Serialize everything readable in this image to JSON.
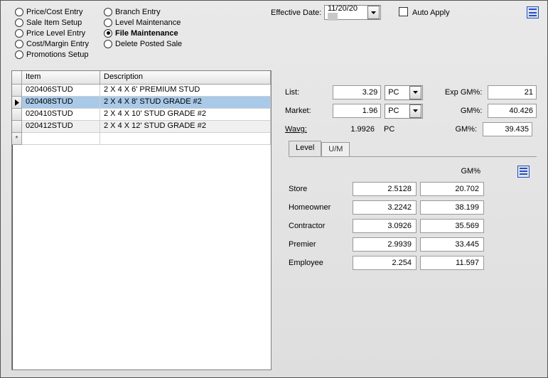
{
  "header": {
    "radio_col1": [
      {
        "label": "Price/Cost Entry",
        "selected": false
      },
      {
        "label": "Sale Item Setup",
        "selected": false
      },
      {
        "label": "Price Level Entry",
        "selected": false
      },
      {
        "label": "Cost/Margin Entry",
        "selected": false
      },
      {
        "label": "Promotions Setup",
        "selected": false
      }
    ],
    "radio_col2": [
      {
        "label": "Branch Entry",
        "selected": false
      },
      {
        "label": "Level Maintenance",
        "selected": false
      },
      {
        "label": "File Maintenance",
        "selected": true
      },
      {
        "label": "Delete Posted Sale",
        "selected": false
      }
    ],
    "effective_date_label": "Effective Date:",
    "effective_date_value": "11/20/20",
    "auto_apply_label": "Auto Apply"
  },
  "grid": {
    "columns": {
      "item": "Item",
      "description": "Description"
    },
    "rows": [
      {
        "item": "020406STUD",
        "desc": "2 X 4 X 6' PREMIUM STUD",
        "selected": false,
        "pointer": false
      },
      {
        "item": "020408STUD",
        "desc": "2 X 4 X 8' STUD GRADE #2",
        "selected": true,
        "pointer": true
      },
      {
        "item": "020410STUD",
        "desc": "2 X 4 X 10' STUD GRADE #2",
        "selected": false,
        "pointer": false
      },
      {
        "item": "020412STUD",
        "desc": "2 X 4 X 12' STUD GRADE #2",
        "selected": false,
        "pointer": false
      }
    ],
    "new_marker": "*"
  },
  "detail": {
    "list_label": "List:",
    "list_value": "3.29",
    "list_unit": "PC",
    "exp_gm_label": "Exp GM%:",
    "exp_gm_value": "21",
    "market_label": "Market:",
    "market_value": "1.96",
    "market_unit": "PC",
    "gm1_label": "GM%:",
    "gm1_value": "40.426",
    "wavg_label": "Wavg:",
    "wavg_value": "1.9926",
    "wavg_unit": "PC",
    "gm2_label": "GM%:",
    "gm2_value": "39.435"
  },
  "tabs": {
    "level": "Level",
    "um": "U/M"
  },
  "levels": {
    "gm_header": "GM%",
    "rows": [
      {
        "label": "Store",
        "price": "2.5128",
        "gm": "20.702"
      },
      {
        "label": "Homeowner",
        "price": "3.2242",
        "gm": "38.199"
      },
      {
        "label": "Contractor",
        "price": "3.0926",
        "gm": "35.569"
      },
      {
        "label": "Premier",
        "price": "2.9939",
        "gm": "33.445"
      },
      {
        "label": "Employee",
        "price": "2.254",
        "gm": "11.597"
      }
    ]
  }
}
